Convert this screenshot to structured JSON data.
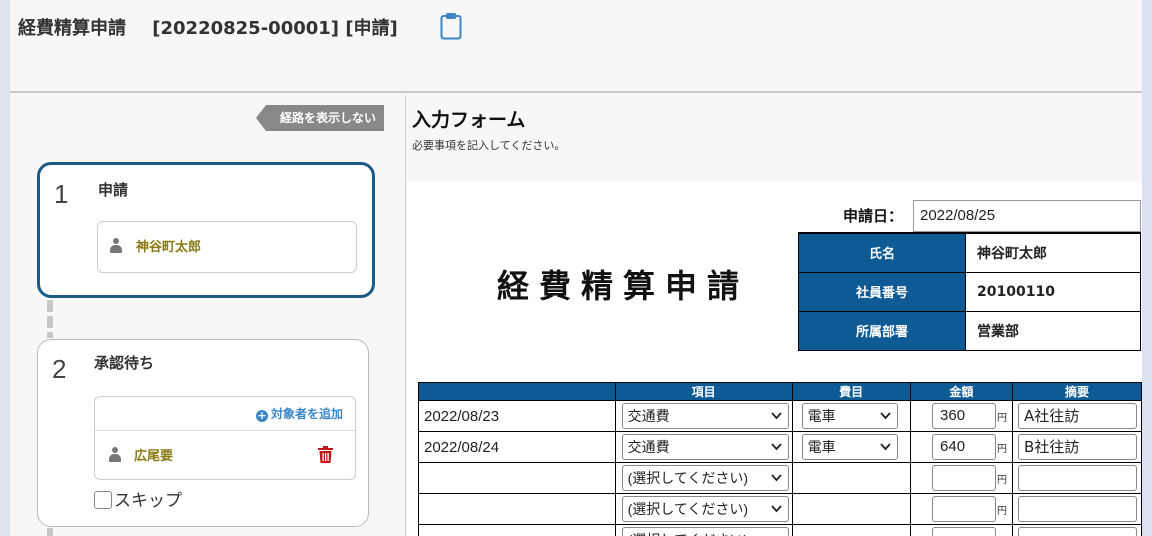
{
  "header": {
    "title": "経費精算申請",
    "doc_number": "[20220825-00001]",
    "status": "[申請]",
    "icon": "clipboard-icon"
  },
  "route": {
    "hide_button": "経路を表示しない",
    "steps": [
      {
        "num": "1",
        "name": "申請",
        "person": "神谷町太郎"
      },
      {
        "num": "2",
        "name": "承認待ち",
        "add_target": "対象者を追加",
        "person": "広尾要",
        "skip_label": "スキップ"
      }
    ]
  },
  "form": {
    "title": "入力フォーム",
    "subtitle": "必要事項を記入してください。",
    "date_label": "申請日：",
    "date_value": "2022/08/25",
    "doc_title": "経費精算申請",
    "info": [
      {
        "label": "氏名",
        "value": "神谷町太郎"
      },
      {
        "label": "社員番号",
        "value": "20100110"
      },
      {
        "label": "所属部署",
        "value": "営業部"
      }
    ],
    "table": {
      "headers": [
        "",
        "項目",
        "費目",
        "金額",
        "摘要"
      ],
      "yen": "円",
      "rows": [
        {
          "date": "2022/08/23",
          "item": "交通費",
          "category": "電車",
          "amount": "360",
          "memo": "A社往訪"
        },
        {
          "date": "2022/08/24",
          "item": "交通費",
          "category": "電車",
          "amount": "640",
          "memo": "B社往訪"
        },
        {
          "date": "",
          "item": "(選択してください)",
          "category": "",
          "amount": "",
          "memo": ""
        },
        {
          "date": "",
          "item": "(選択してください)",
          "category": "",
          "amount": "",
          "memo": ""
        },
        {
          "date": "",
          "item": "(選択してください)",
          "category": "",
          "amount": "",
          "memo": ""
        }
      ]
    }
  },
  "colors": {
    "accent": "#0e5a95",
    "active_step_border": "#1c5b86",
    "person_name": "#8a7a14",
    "link": "#3d86c6",
    "delete": "#c0161a"
  }
}
